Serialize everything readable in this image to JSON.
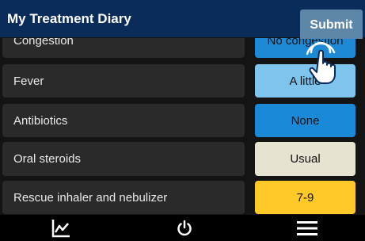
{
  "header": {
    "title": "My Treatment Diary",
    "submit_label": "Submit"
  },
  "rows": [
    {
      "label": "Congestion",
      "value": "No congestion",
      "color": "#1e8ad6"
    },
    {
      "label": "Fever",
      "value": "A little",
      "color": "#7fc4ec"
    },
    {
      "label": "Antibiotics",
      "value": "None",
      "color": "#1a8ad8"
    },
    {
      "label": "Oral steroids",
      "value": "Usual",
      "color": "#e6e3d1"
    },
    {
      "label": "Rescue inhaler and nebulizer",
      "value": "7-9",
      "color": "#ffc928"
    }
  ],
  "footer": {
    "icons": [
      "chart-icon",
      "power-icon",
      "menu-icon"
    ]
  }
}
